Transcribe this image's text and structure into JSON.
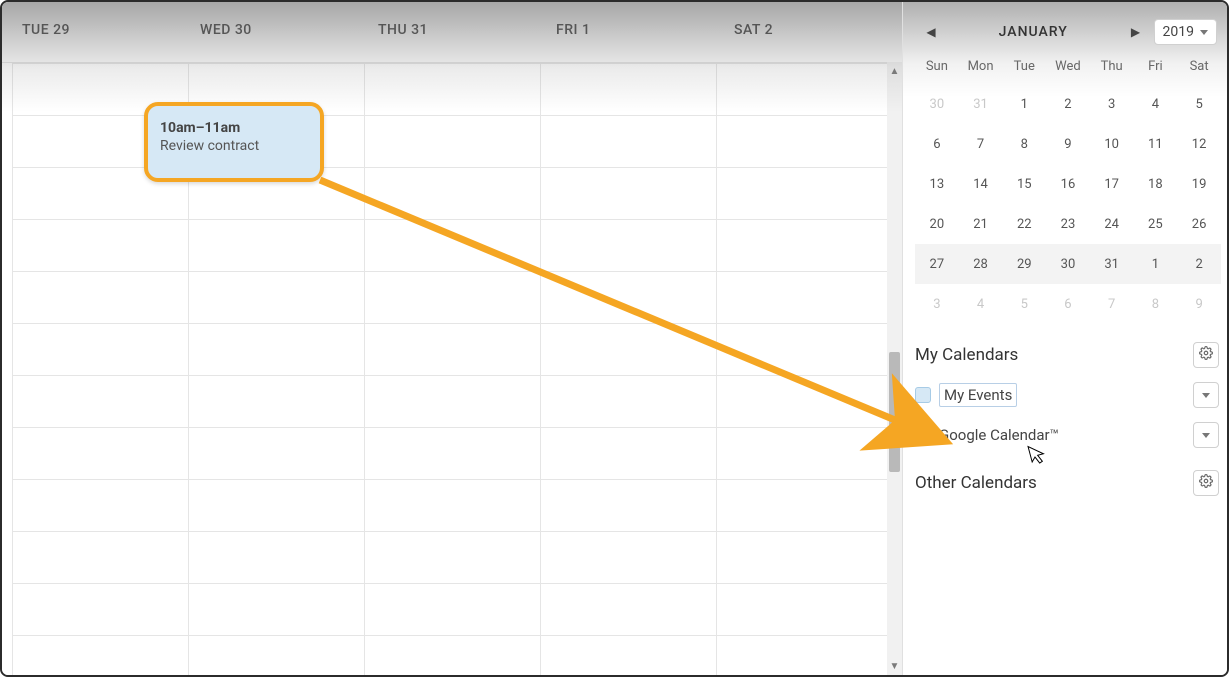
{
  "day_headers": [
    "TUE 29",
    "WED 30",
    "THU 31",
    "FRI 1",
    "SAT 2"
  ],
  "event": {
    "time": "10am–11am",
    "title": "Review contract"
  },
  "minicalendar": {
    "month_label": "JANUARY",
    "year": "2019",
    "weekdays": [
      "Sun",
      "Mon",
      "Tue",
      "Wed",
      "Thu",
      "Fri",
      "Sat"
    ],
    "rows": [
      {
        "shade": false,
        "cells": [
          {
            "n": "30",
            "other": true
          },
          {
            "n": "31",
            "other": true
          },
          {
            "n": "1"
          },
          {
            "n": "2"
          },
          {
            "n": "3"
          },
          {
            "n": "4"
          },
          {
            "n": "5"
          }
        ]
      },
      {
        "shade": false,
        "cells": [
          {
            "n": "6"
          },
          {
            "n": "7"
          },
          {
            "n": "8"
          },
          {
            "n": "9"
          },
          {
            "n": "10"
          },
          {
            "n": "11"
          },
          {
            "n": "12"
          }
        ]
      },
      {
        "shade": false,
        "cells": [
          {
            "n": "13"
          },
          {
            "n": "14"
          },
          {
            "n": "15"
          },
          {
            "n": "16"
          },
          {
            "n": "17"
          },
          {
            "n": "18"
          },
          {
            "n": "19"
          }
        ]
      },
      {
        "shade": false,
        "cells": [
          {
            "n": "20"
          },
          {
            "n": "21"
          },
          {
            "n": "22"
          },
          {
            "n": "23"
          },
          {
            "n": "24"
          },
          {
            "n": "25"
          },
          {
            "n": "26"
          }
        ]
      },
      {
        "shade": true,
        "cells": [
          {
            "n": "27"
          },
          {
            "n": "28"
          },
          {
            "n": "29"
          },
          {
            "n": "30"
          },
          {
            "n": "31"
          },
          {
            "n": "1"
          },
          {
            "n": "2"
          }
        ]
      },
      {
        "shade": false,
        "cells": [
          {
            "n": "3",
            "other": true
          },
          {
            "n": "4",
            "other": true
          },
          {
            "n": "5",
            "other": true
          },
          {
            "n": "6",
            "other": true
          },
          {
            "n": "7",
            "other": true
          },
          {
            "n": "8",
            "other": true
          },
          {
            "n": "9",
            "other": true
          }
        ]
      }
    ]
  },
  "sections": {
    "my_calendars": "My Calendars",
    "other_calendars": "Other Calendars"
  },
  "calendars": {
    "my_events": "My Events",
    "google": "Google Calendar™"
  }
}
